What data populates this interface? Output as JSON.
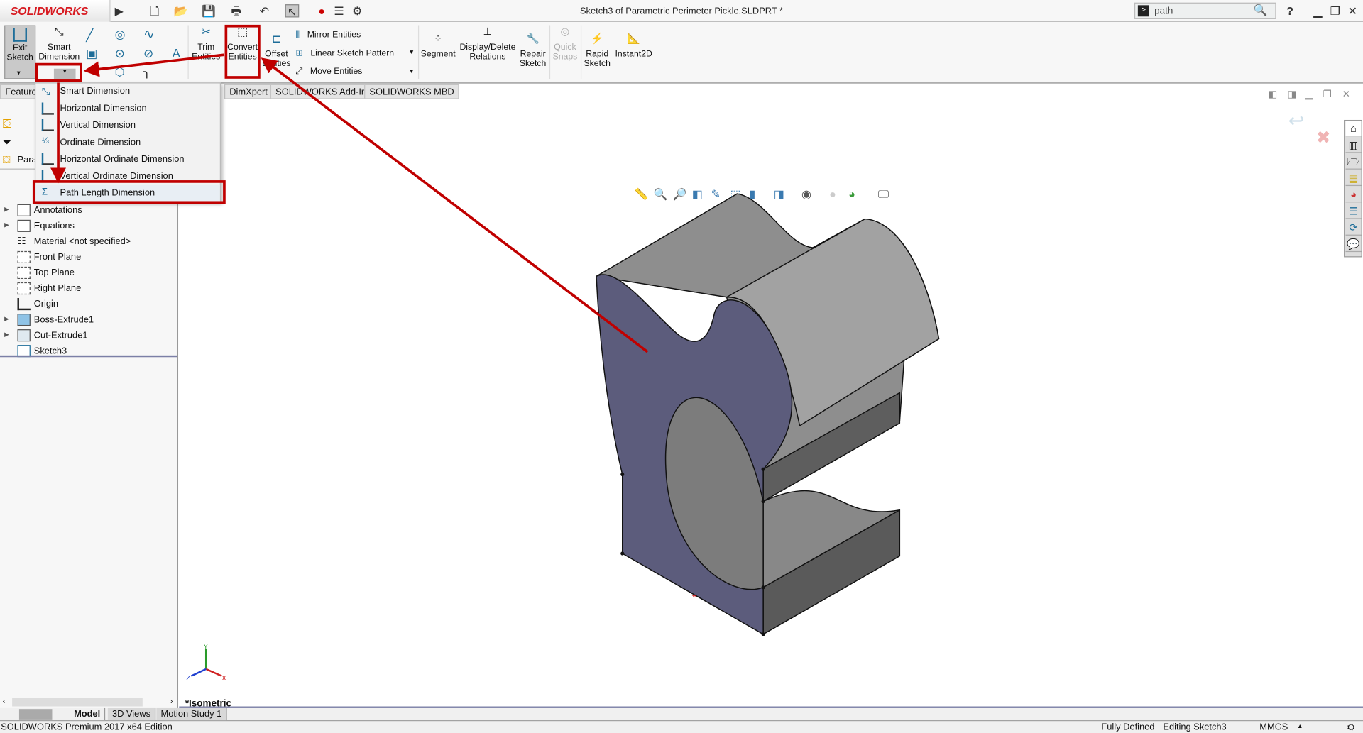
{
  "app": {
    "logo": "SOLIDWORKS",
    "title": "Sketch3 of Parametric Perimeter Pickle.SLDPRT *"
  },
  "search": {
    "value": "path"
  },
  "colors": {
    "accent_red": "#c00000",
    "sketch_face": "#5c5c7c",
    "brand": "#d71920"
  },
  "ribbon": {
    "exit_sketch": "Exit Sketch",
    "smart_dimension": "Smart Dimension",
    "trim": "Trim Entities",
    "convert": "Convert Entities",
    "offset": "Offset Entities",
    "mirror": "Mirror Entities",
    "linear_pattern": "Linear Sketch Pattern",
    "move": "Move Entities",
    "segment": "Segment",
    "display_delete": "Display/Delete Relations",
    "repair": "Repair Sketch",
    "quick_snaps": "Quick Snaps",
    "rapid": "Rapid Sketch",
    "instant2d": "Instant2D"
  },
  "tabs": [
    "Features",
    "DimXpert",
    "SOLIDWORKS Add-Ins",
    "SOLIDWORKS MBD"
  ],
  "dimension_menu": [
    "Smart Dimension",
    "Horizontal Dimension",
    "Vertical Dimension",
    "Ordinate Dimension",
    "Horizontal Ordinate Dimension",
    "Vertical Ordinate Dimension",
    "Path Length Dimension"
  ],
  "tree": {
    "root": "Parametric Perimeter Pickle",
    "items": [
      "Annotations",
      "Equations",
      "Material <not specified>",
      "Front Plane",
      "Top Plane",
      "Right Plane",
      "Origin",
      "Boss-Extrude1",
      "Cut-Extrude1",
      "Sketch3"
    ]
  },
  "viewport": {
    "view_name": "*Isometric",
    "triad": {
      "x": "X",
      "y": "Y",
      "z": "Z"
    }
  },
  "bottom_tabs": [
    "Model",
    "3D Views",
    "Motion Study 1"
  ],
  "status": {
    "edition": "SOLIDWORKS Premium 2017 x64 Edition",
    "defined": "Fully Defined",
    "editing": "Editing Sketch3",
    "units": "MMGS"
  }
}
